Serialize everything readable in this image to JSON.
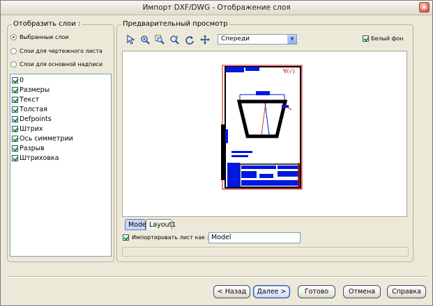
{
  "window": {
    "title": "Импорт DXF/DWG - Отображение слоя"
  },
  "layers_panel": {
    "legend": "Отобразить слои :",
    "radios": [
      {
        "label": "Выбранные слои",
        "selected": true
      },
      {
        "label": "Слои для чертежного листа",
        "selected": false
      },
      {
        "label": "Слои для основной надписи",
        "selected": false
      }
    ],
    "layers": [
      {
        "label": "0",
        "checked": true
      },
      {
        "label": "Размеры",
        "checked": true
      },
      {
        "label": "Текст",
        "checked": true
      },
      {
        "label": "Толстая",
        "checked": true
      },
      {
        "label": "Defpoints",
        "checked": true
      },
      {
        "label": "Штрих",
        "checked": true
      },
      {
        "label": "Ось симметрии",
        "checked": true
      },
      {
        "label": "Разрыв",
        "checked": true
      },
      {
        "label": "Штриховка",
        "checked": true
      }
    ]
  },
  "preview_panel": {
    "legend": "Предварительный просмотр",
    "toolbar_icons": [
      "select-cursor-icon",
      "zoom-in-icon",
      "zoom-window-icon",
      "zoom-extents-icon",
      "refresh-icon",
      "pan-icon"
    ],
    "view_select": {
      "value": "Спереди"
    },
    "white_bg": {
      "label": "Белый фон",
      "checked": true
    },
    "tabs": [
      {
        "label": "Model",
        "active": true
      },
      {
        "label": "Layout1",
        "active": false
      }
    ],
    "import_sheet": {
      "label": "Импортировать лист как :",
      "checked": true,
      "value": "Model"
    }
  },
  "buttons": {
    "back": "< Назад",
    "next": "Далее >",
    "done": "Готово",
    "cancel": "Отмена",
    "help": "Справка"
  }
}
